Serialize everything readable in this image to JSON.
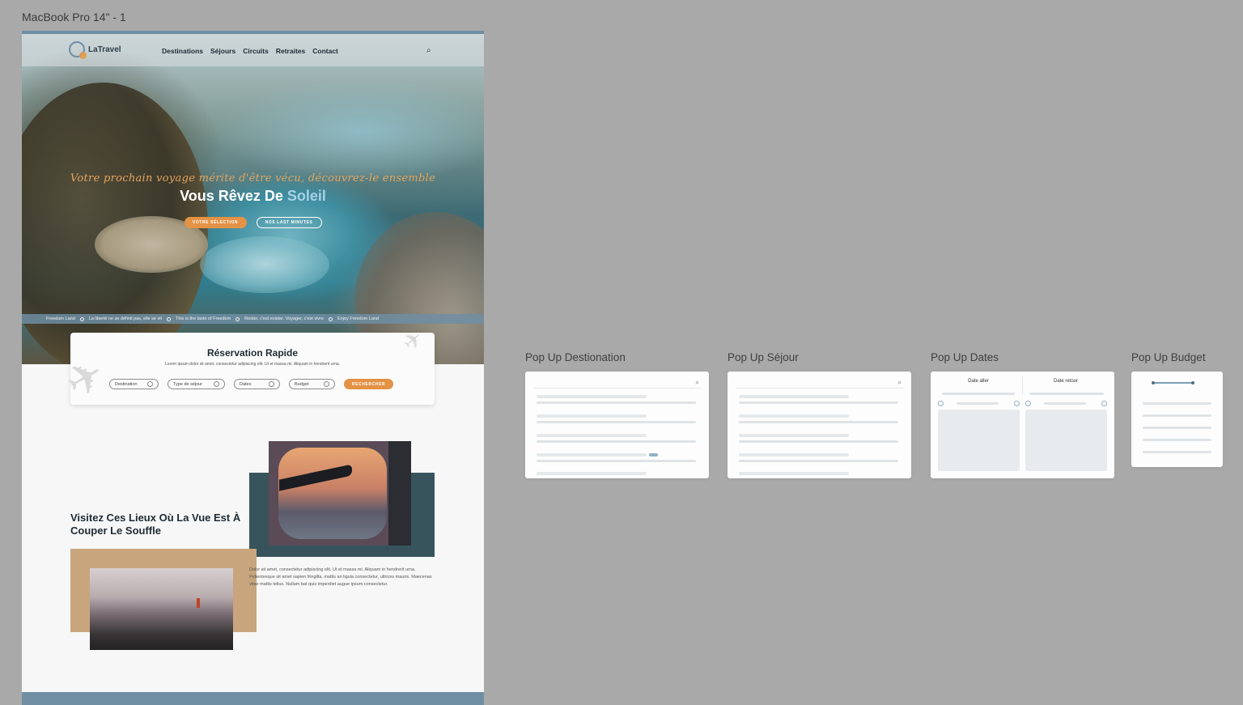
{
  "frame_label": "MacBook Pro 14\" - 1",
  "site": {
    "logo": "LaTravel",
    "nav": [
      "Destinations",
      "Séjours",
      "Circuits",
      "Retraites",
      "Contact"
    ],
    "hero": {
      "script_text": "Votre prochain voyage mérite d'être vécu, découvrez-le ensemble",
      "title_prefix": "Vous Rêvez De ",
      "title_accent": "Soleil",
      "btn_selection": "VOTRE SÉLECTION",
      "btn_last_minutes": "NOS LAST MINUTES"
    },
    "ticker": [
      "Freedom Land",
      "La liberté ne se définit pas, elle se vit",
      "This is the taste of Freedom",
      "Rester, c'est exister. Voyager, c'est vivre",
      "Enjoy Freedom Land"
    ],
    "booking": {
      "title": "Réservation Rapide",
      "subtitle": "Lorem ipsum dolor sit amet, consectetur adipiscing elit. Ut et massa mi. Aliquam in hendrerit urna.",
      "fields": [
        "Destination",
        "Type de séjour",
        "Dates",
        "Budget"
      ],
      "search_btn": "RECHERCHER"
    },
    "section": {
      "title": "Visitez Ces Lieux Où La Vue Est À Couper Le Souffle",
      "body": "Dolor sit amet, consectetur adipiscing elit. Ut et massa mi. Aliquam in hendrerit urna. Pellentesque sit amet sapien fringilla, mattis an ligula consectetur, ultrices mauris. Maecenas vitae mattis tellus. Nullam bat quis imperdiet augue ipsum consectetur."
    }
  },
  "popups": {
    "destination_label": "Pop Up Destionation",
    "sejour_label": "Pop Up Séjour",
    "dates_label": "Pop Up Dates",
    "budget_label": "Pop Up Budget",
    "date_aller": "Date aller",
    "date_retour": "Date retour"
  },
  "colors": {
    "canvas": "#a9a9a9",
    "accent_orange": "#e49245",
    "accent_blue": "#6f8ea3"
  }
}
